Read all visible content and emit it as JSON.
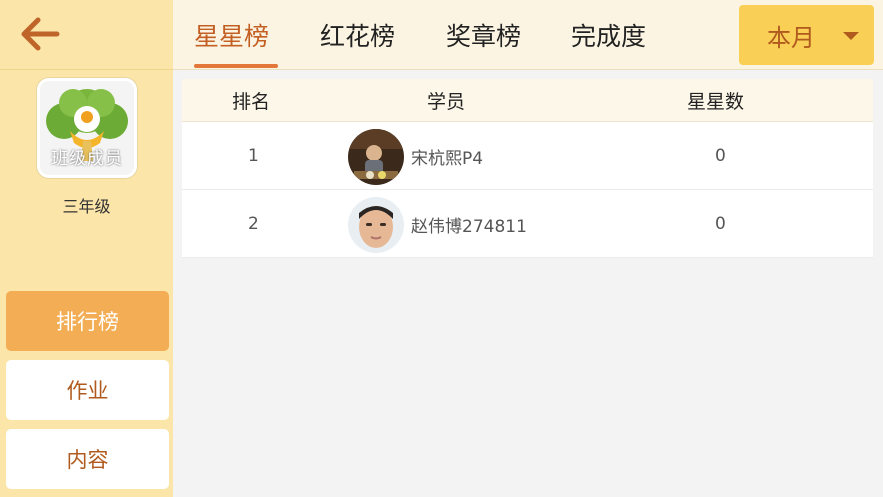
{
  "sidebar": {
    "back_icon": "arrow-left-icon",
    "class_logo_text": "班级成员",
    "grade": "三年级",
    "menu": [
      {
        "label": "排行榜",
        "active": true
      },
      {
        "label": "作业",
        "active": false
      },
      {
        "label": "内容",
        "active": false
      }
    ]
  },
  "tabs": [
    {
      "label": "星星榜",
      "active": true
    },
    {
      "label": "红花榜",
      "active": false
    },
    {
      "label": "奖章榜",
      "active": false
    },
    {
      "label": "完成度",
      "active": false
    }
  ],
  "period": {
    "selected": "本月",
    "icon": "caret-down-icon"
  },
  "table": {
    "headers": {
      "rank": "排名",
      "student": "学员",
      "stars": "星星数"
    },
    "rows": [
      {
        "rank": "1",
        "name": "宋杭熙P4",
        "stars": "0"
      },
      {
        "rank": "2",
        "name": "赵伟博274811",
        "stars": "0"
      }
    ]
  },
  "colors": {
    "sidebar_bg": "#fbe5a8",
    "accent": "#f3ad54",
    "tab_active": "#c45f24",
    "dropdown_bg": "#f9cf55",
    "back_arrow": "#c0652a"
  }
}
